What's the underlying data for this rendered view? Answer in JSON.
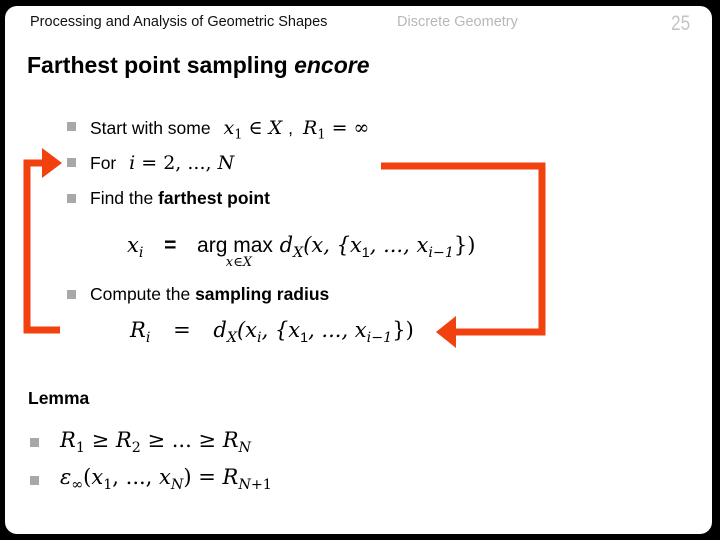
{
  "header": {
    "course": "Processing and Analysis of Geometric Shapes",
    "topic": "Discrete Geometry",
    "page_number": "25"
  },
  "slide_title": {
    "main": "Farthest point sampling",
    "emphasis": "encore"
  },
  "algorithm": {
    "step1": {
      "text": "Start with some",
      "math_a": "x₁ ∈ X",
      "sep": ",",
      "math_b": "R₁ = ∞"
    },
    "step2": {
      "text": "For",
      "math": "i = 2, ..., N"
    },
    "step3": {
      "text": "Find the",
      "bold": "farthest point",
      "equation": {
        "lhs": "x",
        "lhs_sub": "i",
        "eq": "=",
        "op": "arg max",
        "op_under": "x∈X",
        "d": "d",
        "d_sub": "X",
        "args_open": "(x, {x",
        "a1_sub": "1",
        "mid": ", ..., x",
        "an_sub": "i−1",
        "close": "})"
      }
    },
    "step4": {
      "text": "Compute the",
      "bold": "sampling radius",
      "equation": {
        "lhs": "R",
        "lhs_sub": "i",
        "eq": "=",
        "d": "d",
        "d_sub": "X",
        "args_open": "(x",
        "xi_sub": "i",
        "comma": ", {x",
        "a1_sub": "1",
        "mid": ", ..., x",
        "an_sub": "i−1",
        "close": "})"
      }
    }
  },
  "lemma": {
    "heading": "Lemma",
    "items": [
      {
        "text": "R₁ ≥ R₂ ≥ ... ≥ R_N"
      },
      {
        "text": "ε∞(x₁, ..., x_N) = R_{N+1}"
      }
    ]
  },
  "colors": {
    "arrow": "#f0410f",
    "bullet": "#a8a8a8",
    "topic_text": "#b8b8b8",
    "page_number": "#c4c4c4"
  }
}
